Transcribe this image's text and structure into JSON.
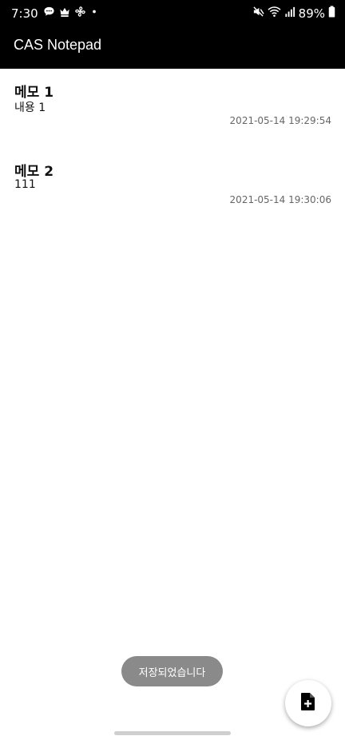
{
  "status_bar": {
    "time": "7:30",
    "battery": "89%",
    "left_icons": [
      "chat-bubble-icon",
      "crown-icon",
      "fan-icon",
      "dot-icon"
    ],
    "right_icons": [
      "mute-icon",
      "wifi-icon",
      "signal-icon",
      "battery-icon"
    ]
  },
  "app_bar": {
    "title": "CAS Notepad"
  },
  "memos": [
    {
      "title": "메모 1",
      "content": "내용 1",
      "timestamp": "2021-05-14 19:29:54"
    },
    {
      "title": "메모 2",
      "content": "111",
      "timestamp": "2021-05-14 19:30:06"
    }
  ],
  "toast": {
    "message": "저장되었습니다"
  },
  "fab": {
    "icon": "add-note-icon"
  },
  "colors": {
    "bar_background": "#000000",
    "toast_background": "#8a8a8a",
    "timestamp_text": "#666666"
  }
}
